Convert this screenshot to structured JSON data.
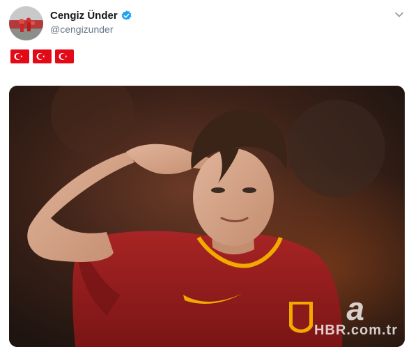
{
  "tweet": {
    "author_name": "Cengiz Ünder",
    "handle": "@cengizunder",
    "flags": [
      "turkey-flag",
      "turkey-flag",
      "turkey-flag"
    ],
    "colors": {
      "verified": "#1da1f2",
      "flag_red": "#e30a17",
      "handle_gray": "#657786",
      "jersey_red": "#9b1c1c",
      "jersey_gold": "#f2a900"
    }
  },
  "media": {
    "watermark_letter": "a",
    "watermark_text": "HBR.com.tr"
  }
}
